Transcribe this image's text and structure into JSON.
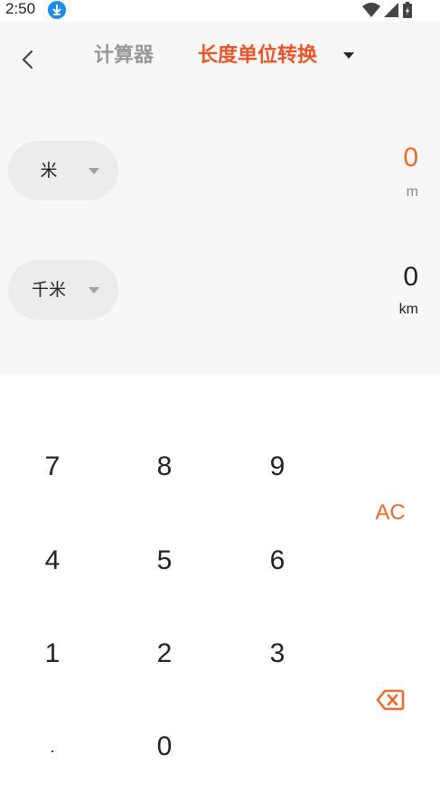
{
  "status": {
    "time": "2:50"
  },
  "header": {
    "tab_calculator": "计算器",
    "tab_converter": "长度单位转换"
  },
  "conversion": {
    "from": {
      "unit": "米",
      "value": "0",
      "abbr": "m"
    },
    "to": {
      "unit": "千米",
      "value": "0",
      "abbr": "km"
    }
  },
  "keypad": {
    "k7": "7",
    "k8": "8",
    "k9": "9",
    "k4": "4",
    "k5": "5",
    "k6": "6",
    "k1": "1",
    "k2": "2",
    "k3": "3",
    "kdot": ".",
    "k0": "0",
    "clear": "AC"
  },
  "colors": {
    "accent": "#f0552a",
    "value_accent": "#f06a2a",
    "display_bg": "#f7f7f7",
    "pill_bg": "#ececec"
  }
}
